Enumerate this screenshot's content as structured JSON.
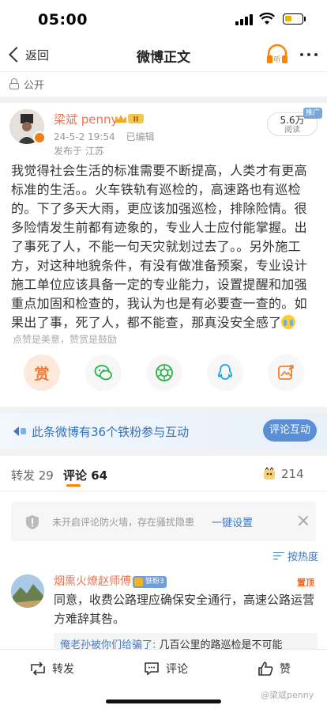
{
  "status_bar": {
    "time": "05:00",
    "battery_level": 0.4
  },
  "nav": {
    "back_label": "返回",
    "title": "微博正文",
    "listen_label": "听"
  },
  "visibility": {
    "label": "公开"
  },
  "author": {
    "name": "梁斌 penny",
    "level_badge": "II",
    "date": "24-5-2 19:54",
    "edited": "已编辑",
    "location": "发布于 江苏"
  },
  "read_stats": {
    "count": "5.6万",
    "label": "阅读",
    "promo": "推广"
  },
  "post": {
    "text": "我觉得社会生活的标准需要不断提高，人类才有更高标准的生活。。火车铁轨有巡检的，高速路也有巡检的。下了多天大雨，更应该加强巡检，排除险情。很多险情发生前都有迹象的，专业人士应付能掌握。出了事死了人，不能一句天灾就划过去了。。另外施工方，对这种地貌条件，有没有做准备预案，专业设计施工单位应该具备一定的专业能力，设置提醒和加强重点加固和检查的，我认为也是有必要查一查的。如果出了事，死了人，都不能查，那真没安全感了",
    "emoji": "crying-face"
  },
  "reward_hint": "点赞是美意，赞赏是鼓励",
  "share_actions": [
    {
      "name": "reward",
      "label": "赏",
      "icon": "reward-icon"
    },
    {
      "name": "wechat",
      "icon": "wechat-icon"
    },
    {
      "name": "moments",
      "icon": "moments-icon"
    },
    {
      "name": "qq",
      "icon": "qq-icon"
    },
    {
      "name": "image",
      "icon": "image-share-icon"
    }
  ],
  "interaction": {
    "text": "此条微博有36个铁粉参与互动",
    "button": "评论互动"
  },
  "tabs": {
    "repost": "转发 29",
    "comment": "评论 64",
    "like_count": "214"
  },
  "notice": {
    "text": "未开启评论防火墙，存在骚扰隐患",
    "link": "一键设置"
  },
  "sort": {
    "label": "按热度"
  },
  "comment": {
    "name": "烟熏火燎赵师傅",
    "fan_badge": "铁粉3",
    "tag": "置顶",
    "text": "同意，收费公路理应确保安全通行，高速公路运营方难辞其咎。",
    "reply_user": "俺老孙被你们给骗了:",
    "reply_text": " 几百公里的路巡检是不可能"
  },
  "bottom_bar": {
    "repost": "转发",
    "comment": "评论",
    "like": "赞"
  },
  "watermark": "@梁斌penny",
  "colors": {
    "accent_orange": "#ff8200",
    "name_orange": "#eb7350",
    "link_blue": "#3e78c4",
    "button_blue": "#5a8fd6"
  }
}
